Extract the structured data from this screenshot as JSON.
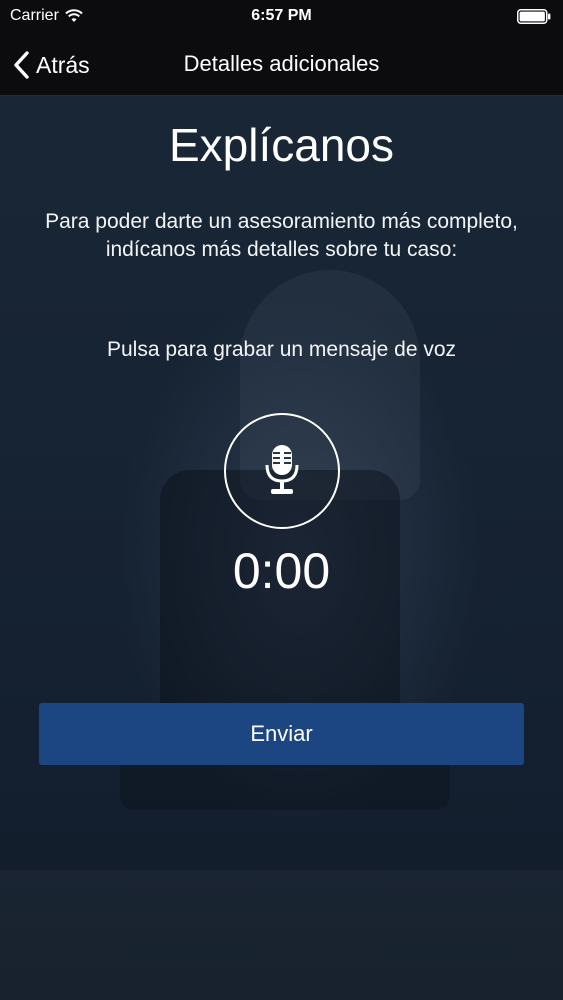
{
  "status_bar": {
    "carrier": "Carrier",
    "time": "6:57 PM",
    "wifi_icon": "wifi-icon",
    "battery_icon": "battery-full-icon"
  },
  "nav": {
    "back_label": "Atrás",
    "back_icon": "chevron-left-icon",
    "title": "Detalles adicionales"
  },
  "main": {
    "heading": "Explícanos",
    "description": "Para poder darte un asesoramiento más completo, indícanos más detalles sobre tu caso:",
    "instruction": "Pulsa para grabar un mensaje de voz",
    "record_icon": "microphone-icon",
    "timer": "0:00",
    "send_label": "Enviar"
  },
  "colors": {
    "bars": "#0c0c0e",
    "background": "#172434",
    "button": "#1b4682",
    "text": "#ffffff"
  }
}
